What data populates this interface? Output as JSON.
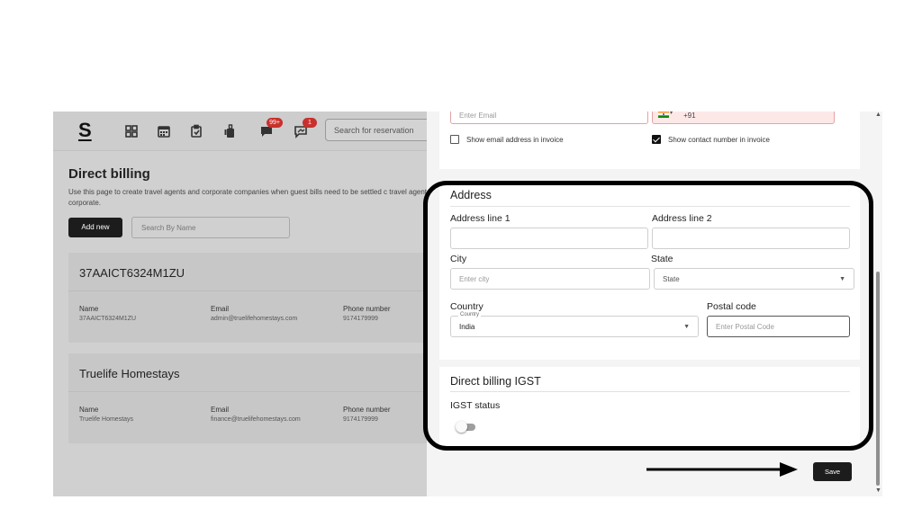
{
  "app": {
    "logo": "S",
    "badges": {
      "messages": "99+",
      "notifications": "1"
    },
    "search_reservation_placeholder": "Search for reservation",
    "icons": [
      "dashboard-icon",
      "calendar-icon",
      "checklist-icon",
      "luggage-icon",
      "chat-icon",
      "notification-icon"
    ]
  },
  "page": {
    "title": "Direct billing",
    "description": "Use this page to create travel agents and corporate companies when guest bills need to be settled c travel agent or corporate.",
    "add_new_label": "Add new",
    "search_by_name_placeholder": "Search By Name"
  },
  "agents": [
    {
      "title": "37AAICT6324M1ZU",
      "name_label": "Name",
      "name": "37AAICT6324M1ZU",
      "email_label": "Email",
      "email": "admin@truelifehomestays.com",
      "phone_label": "Phone number",
      "phone": "9174179999"
    },
    {
      "title": "Truelife Homestays",
      "name_label": "Name",
      "name": "Truelife Homestays",
      "email_label": "Email",
      "email": "finance@truelifehomestays.com",
      "phone_label": "Phone number",
      "phone": "9174179999"
    }
  ],
  "form": {
    "contact": {
      "email_placeholder": "Enter Email",
      "phone_code": "+91",
      "show_email_label": "Show email address in invoice",
      "show_email_checked": false,
      "show_contact_label": "Show contact number in invoice",
      "show_contact_checked": true
    },
    "address": {
      "title": "Address",
      "line1_label": "Address line 1",
      "line2_label": "Address line 2",
      "city_label": "City",
      "city_placeholder": "Enter city",
      "state_label": "State",
      "state_value": "State",
      "country_label": "Country",
      "country_legend": "Country",
      "country_value": "India",
      "postal_label": "Postal code",
      "postal_placeholder": "Enter Postal Code"
    },
    "igst": {
      "title": "Direct billing IGST",
      "status_label": "IGST status",
      "enabled": false
    },
    "save_label": "Save"
  },
  "colors": {
    "accent": "#1c1c1c",
    "badge": "#c9302c",
    "error_border": "#e3a3a3",
    "error_fill": "#fde8e8"
  }
}
